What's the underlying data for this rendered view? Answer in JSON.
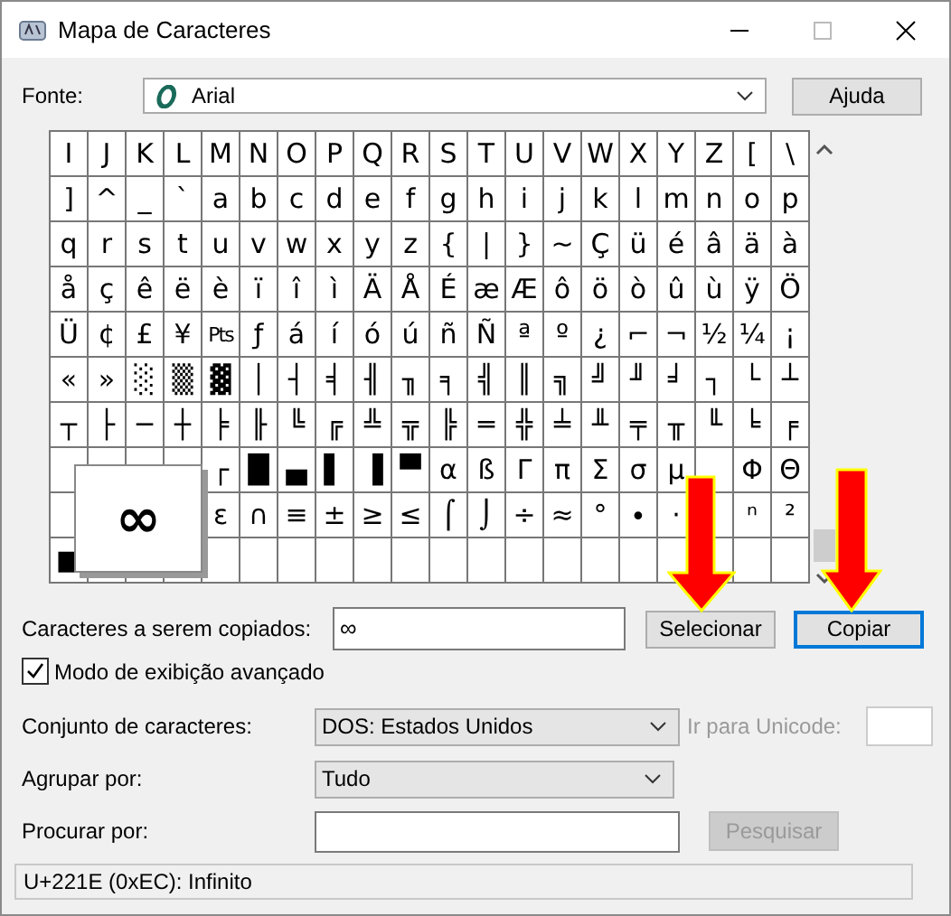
{
  "window": {
    "title": "Mapa de Caracteres"
  },
  "font": {
    "label": "Fonte:",
    "value": "Arial"
  },
  "help_button": "Ajuda",
  "grid": {
    "rows": [
      [
        "I",
        "J",
        "K",
        "L",
        "M",
        "N",
        "O",
        "P",
        "Q",
        "R",
        "S",
        "T",
        "U",
        "V",
        "W",
        "X",
        "Y",
        "Z",
        "[",
        "\\"
      ],
      [
        "]",
        "^",
        "_",
        "`",
        "a",
        "b",
        "c",
        "d",
        "e",
        "f",
        "g",
        "h",
        "i",
        "j",
        "k",
        "l",
        "m",
        "n",
        "o",
        "p"
      ],
      [
        "q",
        "r",
        "s",
        "t",
        "u",
        "v",
        "w",
        "x",
        "y",
        "z",
        "{",
        "|",
        "}",
        "~",
        "Ç",
        "ü",
        "é",
        "â",
        "ä",
        "à"
      ],
      [
        "å",
        "ç",
        "ê",
        "ë",
        "è",
        "ï",
        "î",
        "ì",
        "Ä",
        "Å",
        "É",
        "æ",
        "Æ",
        "ô",
        "ö",
        "ò",
        "û",
        "ù",
        "ÿ",
        "Ö"
      ],
      [
        "Ü",
        "¢",
        "£",
        "¥",
        "Pts",
        "ƒ",
        "á",
        "í",
        "ó",
        "ú",
        "ñ",
        "Ñ",
        "ª",
        "º",
        "¿",
        "⌐",
        "¬",
        "½",
        "¼",
        "¡"
      ],
      [
        "«",
        "»",
        "░",
        "▒",
        "▓",
        "│",
        "┤",
        "╡",
        "╢",
        "╖",
        "╕",
        "╣",
        "║",
        "╗",
        "╝",
        "╜",
        "╛",
        "┐",
        "└",
        "┴"
      ],
      [
        "┬",
        "├",
        "─",
        "┼",
        "╞",
        "╟",
        "╚",
        "╔",
        "╩",
        "╦",
        "╠",
        "═",
        "╬",
        "╧",
        "╨",
        "╤",
        "╥",
        "╙",
        "╘",
        "╒"
      ],
      [
        null,
        null,
        null,
        null,
        "┌",
        "█",
        "▄",
        "▌",
        "▐",
        "▀",
        "α",
        "ß",
        "Γ",
        "π",
        "Σ",
        "σ",
        "µ",
        null,
        "Φ",
        "Θ"
      ],
      [
        null,
        null,
        null,
        null,
        "ε",
        "∩",
        "≡",
        "±",
        "≥",
        "≤",
        "⌠",
        "⌡",
        "÷",
        "≈",
        "°",
        "∙",
        "·",
        null,
        "ⁿ",
        "²"
      ],
      [
        "■",
        null,
        null,
        null,
        null,
        null,
        null,
        null,
        null,
        null,
        null,
        null,
        null,
        null,
        null,
        null,
        null,
        null,
        null,
        null
      ]
    ],
    "magnified": "∞"
  },
  "copy": {
    "label": "Caracteres a serem copiados:",
    "value": "∞"
  },
  "buttons": [
    {
      "label": "Selecionar",
      "focused": false
    },
    {
      "label": "Copiar",
      "focused": true
    }
  ],
  "advanced_view": {
    "label": "Modo de exibição avançado",
    "checked": true
  },
  "charset": {
    "label": "Conjunto de caracteres:",
    "value": "DOS: Estados Unidos"
  },
  "goto_unicode": {
    "label": "Ir para Unicode:",
    "disabled": true
  },
  "group_by": {
    "label": "Agrupar por:",
    "value": "Tudo"
  },
  "search": {
    "label": "Procurar por:",
    "button": "Pesquisar",
    "disabled": true
  },
  "status_bar": "U+221E (0xEC): Infinito"
}
